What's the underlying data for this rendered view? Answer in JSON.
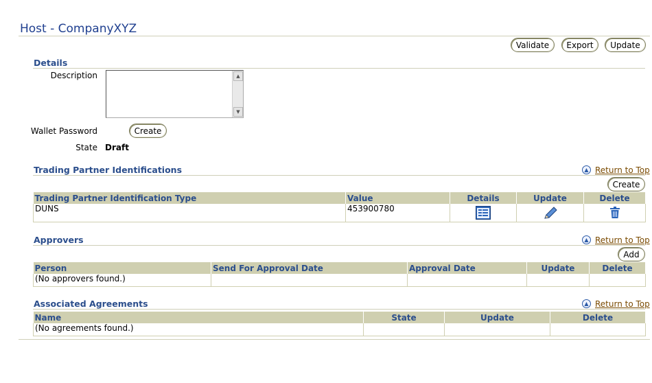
{
  "page": {
    "title": "Host - CompanyXYZ"
  },
  "toolbar": {
    "validate_label": "Validate",
    "export_label": "Export",
    "update_label": "Update"
  },
  "details": {
    "title": "Details",
    "description_label": "Description",
    "description_value": "",
    "wallet_password_label": "Wallet Password",
    "wallet_create_label": "Create",
    "state_label": "State",
    "state_value": "Draft"
  },
  "return_to_top_label": "Return to Top",
  "trading_partner": {
    "title": "Trading Partner Identifications",
    "create_label": "Create",
    "columns": [
      "Trading Partner Identification Type",
      "Value",
      "Details",
      "Update",
      "Delete"
    ],
    "rows": [
      {
        "type": "DUNS",
        "value": "453900780"
      }
    ],
    "icons": {
      "details": "details-icon",
      "update": "pencil-icon",
      "delete": "trash-icon"
    }
  },
  "approvers": {
    "title": "Approvers",
    "add_label": "Add",
    "columns": [
      "Person",
      "Send For Approval Date",
      "Approval Date",
      "Update",
      "Delete"
    ],
    "empty_text": "(No approvers found.)"
  },
  "agreements": {
    "title": "Associated Agreements",
    "columns": [
      "Name",
      "State",
      "Update",
      "Delete"
    ],
    "empty_text": "(No agreements found.)"
  },
  "colors": {
    "title": "#1f3f8f",
    "header_bg": "#cfcfb0",
    "link": "#7a4a00"
  }
}
